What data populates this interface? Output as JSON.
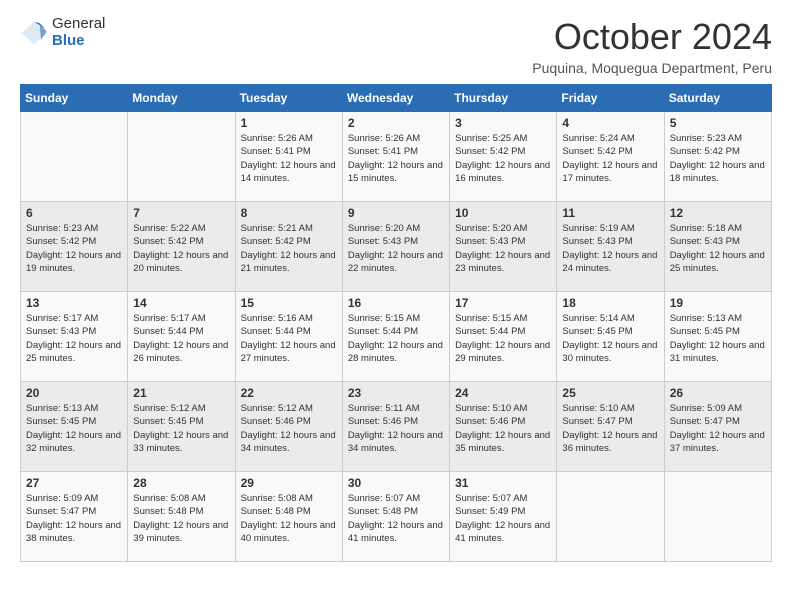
{
  "logo": {
    "general": "General",
    "blue": "Blue"
  },
  "header": {
    "month": "October 2024",
    "location": "Puquina, Moquegua Department, Peru"
  },
  "weekdays": [
    "Sunday",
    "Monday",
    "Tuesday",
    "Wednesday",
    "Thursday",
    "Friday",
    "Saturday"
  ],
  "weeks": [
    [
      {
        "day": "",
        "info": ""
      },
      {
        "day": "",
        "info": ""
      },
      {
        "day": "1",
        "info": "Sunrise: 5:26 AM\nSunset: 5:41 PM\nDaylight: 12 hours and 14 minutes."
      },
      {
        "day": "2",
        "info": "Sunrise: 5:26 AM\nSunset: 5:41 PM\nDaylight: 12 hours and 15 minutes."
      },
      {
        "day": "3",
        "info": "Sunrise: 5:25 AM\nSunset: 5:42 PM\nDaylight: 12 hours and 16 minutes."
      },
      {
        "day": "4",
        "info": "Sunrise: 5:24 AM\nSunset: 5:42 PM\nDaylight: 12 hours and 17 minutes."
      },
      {
        "day": "5",
        "info": "Sunrise: 5:23 AM\nSunset: 5:42 PM\nDaylight: 12 hours and 18 minutes."
      }
    ],
    [
      {
        "day": "6",
        "info": "Sunrise: 5:23 AM\nSunset: 5:42 PM\nDaylight: 12 hours and 19 minutes."
      },
      {
        "day": "7",
        "info": "Sunrise: 5:22 AM\nSunset: 5:42 PM\nDaylight: 12 hours and 20 minutes."
      },
      {
        "day": "8",
        "info": "Sunrise: 5:21 AM\nSunset: 5:42 PM\nDaylight: 12 hours and 21 minutes."
      },
      {
        "day": "9",
        "info": "Sunrise: 5:20 AM\nSunset: 5:43 PM\nDaylight: 12 hours and 22 minutes."
      },
      {
        "day": "10",
        "info": "Sunrise: 5:20 AM\nSunset: 5:43 PM\nDaylight: 12 hours and 23 minutes."
      },
      {
        "day": "11",
        "info": "Sunrise: 5:19 AM\nSunset: 5:43 PM\nDaylight: 12 hours and 24 minutes."
      },
      {
        "day": "12",
        "info": "Sunrise: 5:18 AM\nSunset: 5:43 PM\nDaylight: 12 hours and 25 minutes."
      }
    ],
    [
      {
        "day": "13",
        "info": "Sunrise: 5:17 AM\nSunset: 5:43 PM\nDaylight: 12 hours and 25 minutes."
      },
      {
        "day": "14",
        "info": "Sunrise: 5:17 AM\nSunset: 5:44 PM\nDaylight: 12 hours and 26 minutes."
      },
      {
        "day": "15",
        "info": "Sunrise: 5:16 AM\nSunset: 5:44 PM\nDaylight: 12 hours and 27 minutes."
      },
      {
        "day": "16",
        "info": "Sunrise: 5:15 AM\nSunset: 5:44 PM\nDaylight: 12 hours and 28 minutes."
      },
      {
        "day": "17",
        "info": "Sunrise: 5:15 AM\nSunset: 5:44 PM\nDaylight: 12 hours and 29 minutes."
      },
      {
        "day": "18",
        "info": "Sunrise: 5:14 AM\nSunset: 5:45 PM\nDaylight: 12 hours and 30 minutes."
      },
      {
        "day": "19",
        "info": "Sunrise: 5:13 AM\nSunset: 5:45 PM\nDaylight: 12 hours and 31 minutes."
      }
    ],
    [
      {
        "day": "20",
        "info": "Sunrise: 5:13 AM\nSunset: 5:45 PM\nDaylight: 12 hours and 32 minutes."
      },
      {
        "day": "21",
        "info": "Sunrise: 5:12 AM\nSunset: 5:45 PM\nDaylight: 12 hours and 33 minutes."
      },
      {
        "day": "22",
        "info": "Sunrise: 5:12 AM\nSunset: 5:46 PM\nDaylight: 12 hours and 34 minutes."
      },
      {
        "day": "23",
        "info": "Sunrise: 5:11 AM\nSunset: 5:46 PM\nDaylight: 12 hours and 34 minutes."
      },
      {
        "day": "24",
        "info": "Sunrise: 5:10 AM\nSunset: 5:46 PM\nDaylight: 12 hours and 35 minutes."
      },
      {
        "day": "25",
        "info": "Sunrise: 5:10 AM\nSunset: 5:47 PM\nDaylight: 12 hours and 36 minutes."
      },
      {
        "day": "26",
        "info": "Sunrise: 5:09 AM\nSunset: 5:47 PM\nDaylight: 12 hours and 37 minutes."
      }
    ],
    [
      {
        "day": "27",
        "info": "Sunrise: 5:09 AM\nSunset: 5:47 PM\nDaylight: 12 hours and 38 minutes."
      },
      {
        "day": "28",
        "info": "Sunrise: 5:08 AM\nSunset: 5:48 PM\nDaylight: 12 hours and 39 minutes."
      },
      {
        "day": "29",
        "info": "Sunrise: 5:08 AM\nSunset: 5:48 PM\nDaylight: 12 hours and 40 minutes."
      },
      {
        "day": "30",
        "info": "Sunrise: 5:07 AM\nSunset: 5:48 PM\nDaylight: 12 hours and 41 minutes."
      },
      {
        "day": "31",
        "info": "Sunrise: 5:07 AM\nSunset: 5:49 PM\nDaylight: 12 hours and 41 minutes."
      },
      {
        "day": "",
        "info": ""
      },
      {
        "day": "",
        "info": ""
      }
    ]
  ]
}
